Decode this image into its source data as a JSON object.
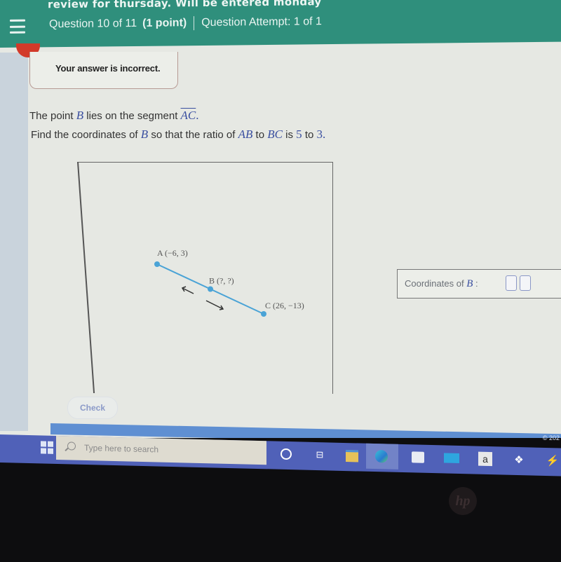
{
  "header": {
    "assignment_title": "review for thursday. Will be entered monday",
    "question_position": "Question 10 of 11",
    "question_points": "(1 point)",
    "attempt_label": "Question Attempt: 1 of 1",
    "menu_icon": "hamburger-menu-icon",
    "color": "#2f8f7c"
  },
  "feedback": {
    "message": "Your answer is incorrect.",
    "status_color": "#d23a2a"
  },
  "question": {
    "line1_prefix": "The point",
    "line1_point": "B",
    "line1_middle": "lies on the segment",
    "line1_segment": "AC",
    "line1_end": ".",
    "line2_prefix": "Find the coordinates of",
    "line2_point": "B",
    "line2_middle": "so that the ratio of",
    "line2_seg1": "AB",
    "line2_to": "to",
    "line2_seg2": "BC",
    "line2_is": "is",
    "ratio_a": "5",
    "ratio_to": "to",
    "ratio_b": "3",
    "ratio_end": "."
  },
  "diagram": {
    "points": [
      {
        "name": "A",
        "label": "A (−6, 3)",
        "x": -6,
        "y": 3
      },
      {
        "name": "B",
        "label": "B (?, ?)",
        "x": null,
        "y": null
      },
      {
        "name": "C",
        "label": "C (26, −13)",
        "x": 26,
        "y": -13
      }
    ],
    "line_color": "#4aa3d6",
    "drag_arrows": [
      "arrow-up-left-icon",
      "arrow-down-right-icon"
    ]
  },
  "answer": {
    "label_prefix": "Coordinates of",
    "label_point": "B",
    "label_colon": ":",
    "x_value": "",
    "y_value": ""
  },
  "buttons": {
    "check_label": "Check"
  },
  "footer": {
    "copyright": "© 202"
  },
  "taskbar": {
    "search_placeholder": "Type here to search",
    "apps": [
      "cortana-icon",
      "task-view-icon",
      "file-explorer-icon",
      "edge-icon",
      "store-icon",
      "mail-icon",
      "amazon-icon",
      "dropbox-icon",
      "app-icon"
    ],
    "amazon_letter": "a"
  },
  "device": {
    "brand": "hp"
  }
}
